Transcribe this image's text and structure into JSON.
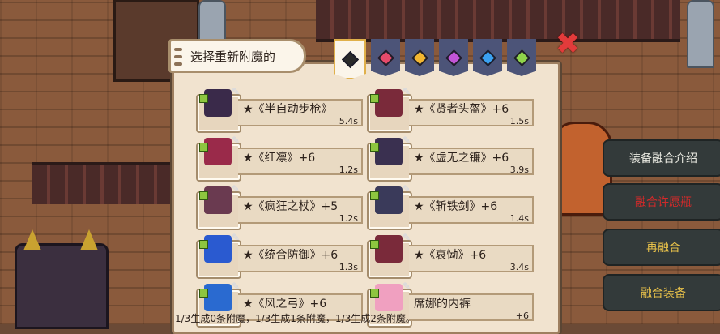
{
  "dialog": {
    "title": "选择重新附魔的",
    "close_glyph": "✖",
    "footer": "1/3生成0条附魔，1/3生成1条附魔，1/3生成2条附魔。"
  },
  "tabs": [
    {
      "color": "#2a2a2a",
      "selected": true
    },
    {
      "color": "#e64a6a",
      "selected": false
    },
    {
      "color": "#f2b630",
      "selected": false
    },
    {
      "color": "#c255d6",
      "selected": false
    },
    {
      "color": "#3aa0f0",
      "selected": false
    },
    {
      "color": "#8fd44a",
      "selected": false
    }
  ],
  "items": [
    {
      "name": "★《半自动步枪》",
      "time": "5.4s",
      "icon": "rifle-icon",
      "color": "#3a2a4a"
    },
    {
      "name": "★《贤者头盔》+6",
      "time": "1.5s",
      "icon": "helmet-icon",
      "color": "#7a2a3a"
    },
    {
      "name": "★《红凛》+6",
      "time": "1.2s",
      "icon": "red-hat-icon",
      "color": "#9a2a4a"
    },
    {
      "name": "★《虚无之镰》+6",
      "time": "3.9s",
      "icon": "scythe-icon",
      "color": "#3a3050"
    },
    {
      "name": "★《疯狂之杖》+5",
      "time": "1.2s",
      "icon": "staff-icon",
      "color": "#6a3a50"
    },
    {
      "name": "★《斩铁剑》+6",
      "time": "1.4s",
      "icon": "sword-icon",
      "color": "#3a3a5a"
    },
    {
      "name": "★《统合防御》+6",
      "time": "1.3s",
      "icon": "shield-gem-icon",
      "color": "#2a5ad0"
    },
    {
      "name": "★《哀恸》+6",
      "time": "3.4s",
      "icon": "blade-icon",
      "color": "#7a2a3a"
    },
    {
      "name": "★《风之弓》+6",
      "time": "",
      "icon": "bow-icon",
      "color": "#2a6ad0"
    },
    {
      "name": "席娜的内裤",
      "time": "+6",
      "icon": "underwear-icon",
      "color": "#f0a0c0"
    }
  ],
  "menu": {
    "fusion_intro": "装备融合介绍",
    "fusion_wish": "融合许愿瓶",
    "refuse": "再融合",
    "fuse_equip": "融合装备"
  }
}
